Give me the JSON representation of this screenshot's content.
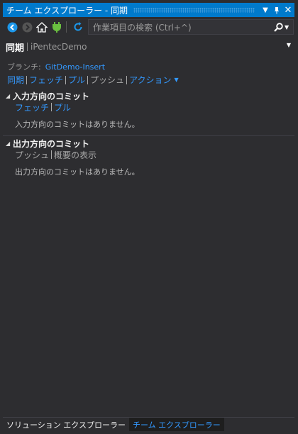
{
  "window": {
    "title": "チーム エクスプローラー - 同期"
  },
  "toolbar": {
    "search_placeholder": "作業項目の検索 (Ctrl+^)"
  },
  "header": {
    "title": "同期",
    "repo": "iPentecDemo"
  },
  "branch": {
    "label": "ブランチ:",
    "name": "GitDemo-Insert"
  },
  "actions": {
    "sync": "同期",
    "fetch": "フェッチ",
    "pull": "プル",
    "push": "プッシュ",
    "action": "アクション"
  },
  "incoming": {
    "title": "入力方向のコミット",
    "fetch": "フェッチ",
    "pull": "プル",
    "empty": "入力方向のコミットはありません。"
  },
  "outgoing": {
    "title": "出力方向のコミット",
    "push": "プッシュ",
    "overview": "概要の表示",
    "empty": "出力方向のコミットはありません。"
  },
  "bottom_tabs": {
    "solution": "ソリューション エクスプローラー",
    "team": "チーム エクスプローラー"
  },
  "colors": {
    "accent": "#007acc",
    "link": "#3399ff",
    "background": "#2d2d30"
  }
}
